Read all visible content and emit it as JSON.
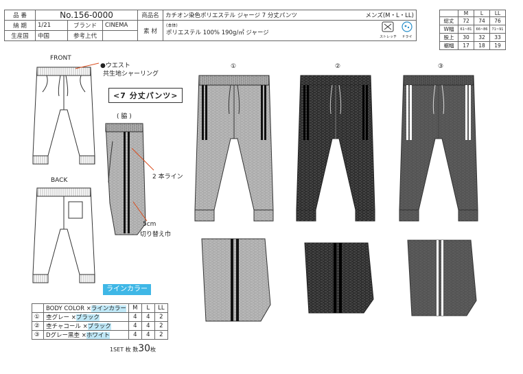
{
  "header": {
    "item_no_label": "品 番",
    "item_no": "No.156-0000",
    "product_name_label": "商品名",
    "product_name": "カチオン染色ポリエステル ジャージ 7 分丈パンツ",
    "gender_sizes": "メンズ(M・L・LL)",
    "delivery_label": "納 期",
    "delivery": "1/21",
    "brand_label": "ブランド",
    "brand": "CINEMA",
    "material_label": "素 材",
    "material_note": "(本体)",
    "material": "ポリエステル  100%  190g/㎡ ジャージ",
    "origin_label": "生産国",
    "origin": "中国",
    "price_label": "参考上代",
    "price": "",
    "care_icons": [
      {
        "icon": "stretch-icon",
        "label": "ストレッチ"
      },
      {
        "icon": "dry-icon",
        "label": "ドライ"
      }
    ]
  },
  "size_chart": {
    "headers": [
      "",
      "M",
      "L",
      "LL"
    ],
    "rows": [
      {
        "name": "総丈",
        "values": [
          "72",
          "74",
          "76"
        ]
      },
      {
        "name": "W幅",
        "values": [
          "61~81",
          "66~86",
          "71~91"
        ]
      },
      {
        "name": "股上",
        "values": [
          "30",
          "32",
          "33"
        ]
      },
      {
        "name": "裾幅",
        "values": [
          "17",
          "18",
          "19"
        ]
      }
    ]
  },
  "labels": {
    "front": "FRONT",
    "back": "BACK",
    "waist": "●ウエスト",
    "waist_detail": "共生地シャーリング",
    "title": "<7 分丈パンツ>",
    "side": "( 脇 )",
    "two_line": "2 本ライン",
    "cut_width": "5cm",
    "cut_width_detail": "切り替え巾",
    "variant_1": "①",
    "variant_2": "②",
    "variant_3": "③",
    "line_color": "ラインカラー"
  },
  "color_table": {
    "headers": [
      "",
      "BODY COLOR ×",
      "ラインカラー",
      "M",
      "L",
      "LL"
    ],
    "rows": [
      {
        "no": "①",
        "body": "杢グレー ×",
        "line": "ブラック",
        "m": "4",
        "l": "4",
        "ll": "2"
      },
      {
        "no": "②",
        "body": "杢チャコール ×",
        "line": "ブラック",
        "m": "4",
        "l": "4",
        "ll": "2"
      },
      {
        "no": "③",
        "body": "Dグレー黒杢 ×",
        "line": "ホワイト",
        "m": "4",
        "l": "4",
        "ll": "2"
      }
    ]
  },
  "set_note": {
    "prefix": "1SET 枚 数",
    "count": "30",
    "suffix": "枚"
  },
  "colors": {
    "grey": "#b9b9b9",
    "charcoal": "#2b2b2b",
    "dark_grey": "#5e5e5e",
    "line_blue": "#3fb7e6"
  }
}
